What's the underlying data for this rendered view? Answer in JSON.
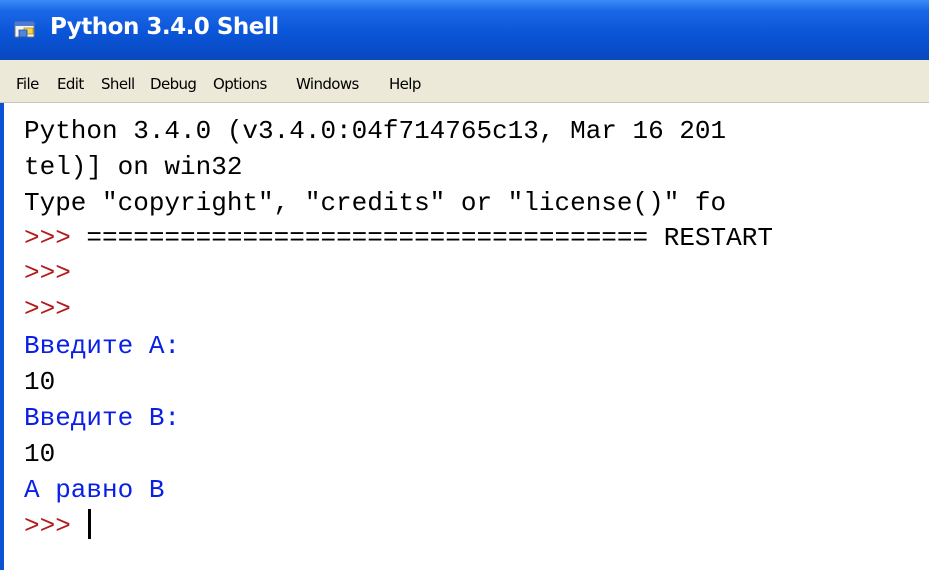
{
  "window": {
    "title": "Python 3.4.0 Shell"
  },
  "menu": {
    "items": [
      "File",
      "Edit",
      "Shell",
      "Debug",
      "Options",
      "Windows",
      "Help"
    ]
  },
  "shell": {
    "lines": [
      "Python 3.4.0 (v3.4.0:04f714765c13, Mar 16 201",
      "tel)] on win32",
      "Type \"copyright\", \"credits\" or \"license()\" fo",
      "==================================== RESTART",
      "Введите A:",
      "10",
      "Введите B:",
      "10",
      "A равно B"
    ],
    "prompt": ">>>"
  },
  "colors": {
    "prompt": "#b31b1b",
    "program_output": "#0a1fe6",
    "title_bar": "#0a55d8"
  }
}
